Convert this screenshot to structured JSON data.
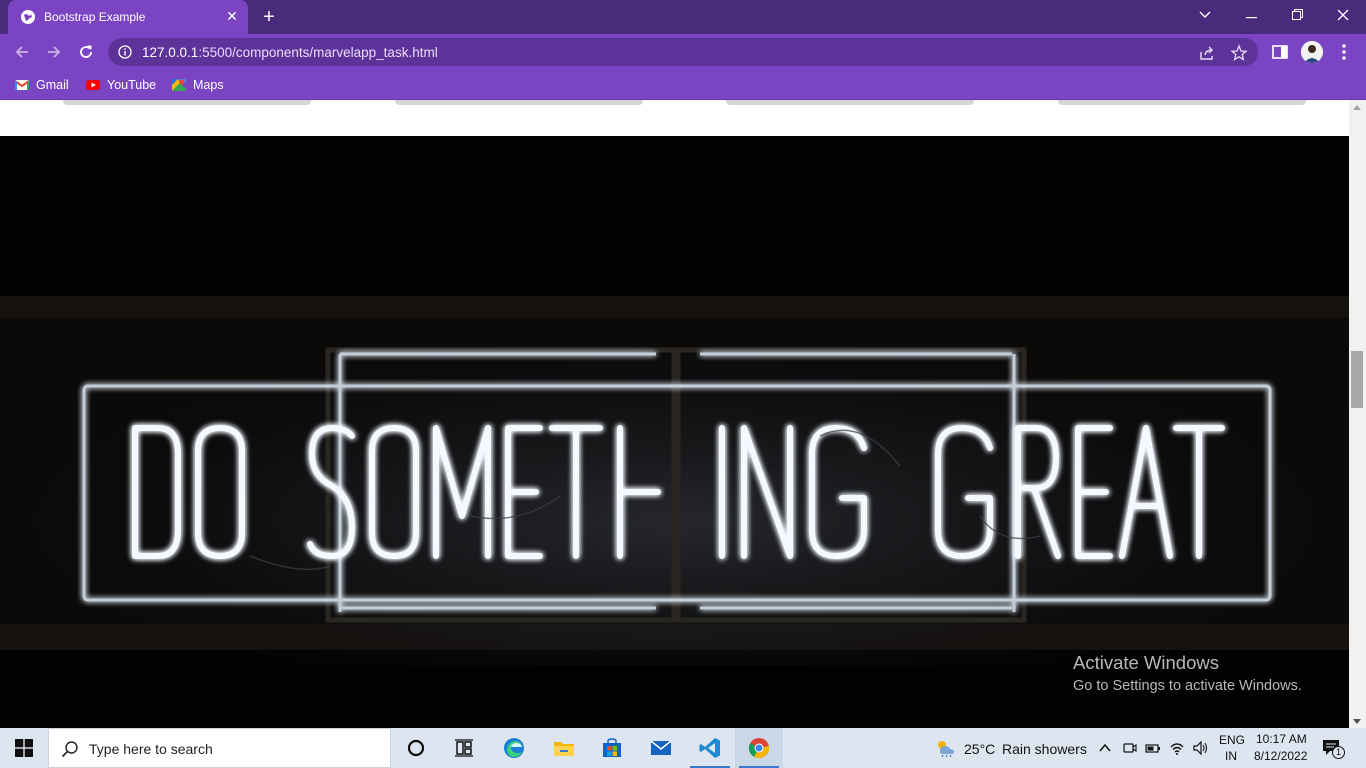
{
  "browser": {
    "tab_title": "Bootstrap Example",
    "url_host": "127.0.0.1",
    "url_rest": ":5500/components/marvelapp_task.html",
    "bookmarks": [
      {
        "label": "Gmail",
        "icon": "gmail-icon"
      },
      {
        "label": "YouTube",
        "icon": "youtube-icon"
      },
      {
        "label": "Maps",
        "icon": "maps-icon"
      }
    ],
    "accent": "#7a44c2"
  },
  "hero": {
    "image_alt": "DO SOMETHING GREAT"
  },
  "watermark": {
    "title": "Activate Windows",
    "subtitle": "Go to Settings to activate Windows."
  },
  "taskbar": {
    "search_placeholder": "Type here to search",
    "weather_temp": "25°C",
    "weather_desc": "Rain showers",
    "language": "ENG",
    "region": "IN",
    "time": "10:17 AM",
    "date": "8/12/2022",
    "notification_count": "1",
    "apps": [
      "cortana-icon",
      "task-view-icon",
      "edge-icon",
      "file-explorer-icon",
      "store-icon",
      "mail-icon",
      "vscode-icon",
      "chrome-icon"
    ]
  }
}
